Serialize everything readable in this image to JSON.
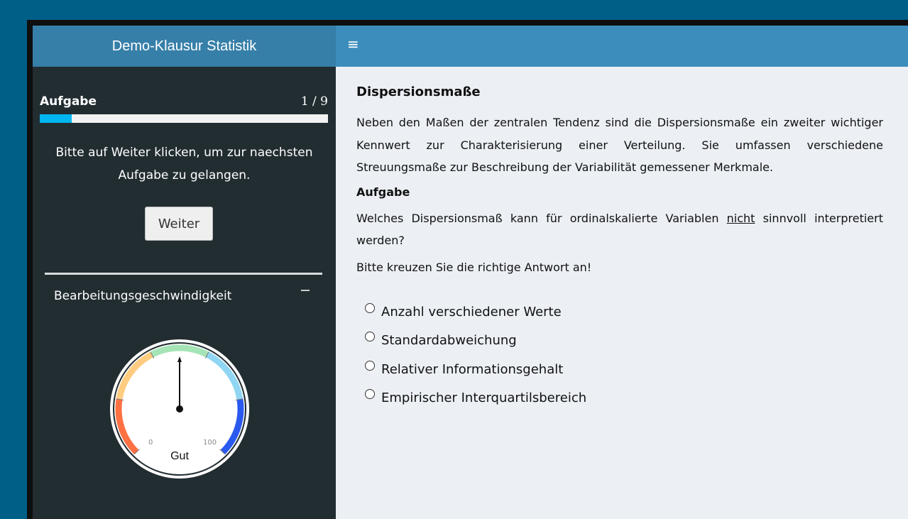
{
  "app": {
    "title": "Demo-Klausur Statistik"
  },
  "sidebar": {
    "task_label": "Aufgabe",
    "task_counter": "1 / 9",
    "progress": 0.11,
    "hint": "Bitte auf Weiter klicken, um zur naechsten Aufgabe zu gelangen.",
    "next_button": "Weiter",
    "speed_panel": {
      "title": "Bearbeitungsgeschwindigkeit",
      "gauge": {
        "min_label": "0",
        "max_label": "100",
        "value_label": "Gut",
        "value": 50,
        "band_colors": [
          "#ff7043",
          "#ffcc80",
          "#a5e4b6",
          "#90d6f2",
          "#2a59f0"
        ]
      }
    }
  },
  "main": {
    "title": "Dispersionsmaße",
    "intro": "Neben den Maßen der zentralen Tendenz sind die Dispersionsmaße ein zweiter wichtiger Kennwert zur Charakterisierung einer Verteilung. Sie umfassen verschiedene Streuungsmaße zur Beschreibung der Variabilität gemessener Merkmale.",
    "task_heading": "Aufgabe",
    "question_pre": "Welches Dispersionsmaß kann für ordinalskalierte Variablen ",
    "question_emph": "nicht",
    "question_post": " sinnvoll interpretiert werden?",
    "instruction": "Bitte kreuzen Sie die richtige Antwort an!",
    "options": [
      "Anzahl verschiedener Werte",
      "Standardabweichung",
      "Relativer Informationsgehalt",
      "Empirischer Interquartilsbereich"
    ]
  }
}
